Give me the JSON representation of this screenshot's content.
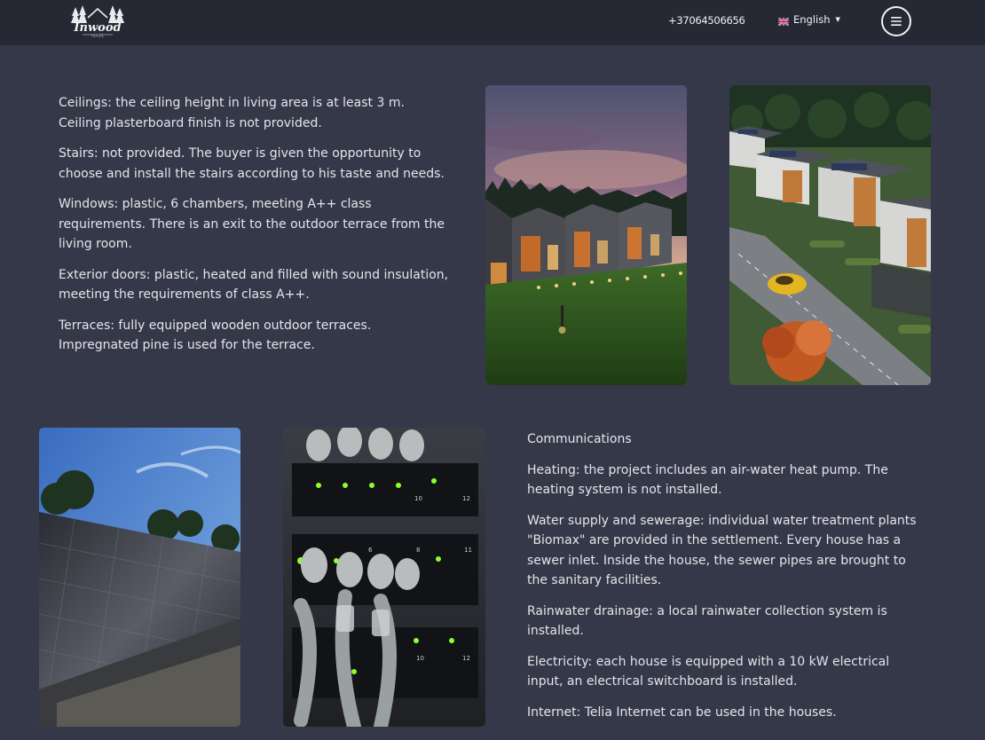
{
  "header": {
    "logo_alt": "Inwood House",
    "phone": "+37064506656",
    "language": "English",
    "menu_icon": "hamburger-icon"
  },
  "section1": {
    "paragraphs": [
      "Ceilings: the ceiling height in living area is at least 3 m. Ceiling plasterboard finish is not provided.",
      "Stairs: not provided. The buyer is given the opportunity to choose and install the stairs according to his taste and needs.",
      "Windows: plastic, 6 chambers, meeting A++ class requirements. There is an exit to the outdoor terrace from the living room.",
      "Exterior doors: plastic, heated and filled with sound insulation, meeting the requirements of class A++.",
      "Terraces: fully equipped wooden outdoor terraces. Impregnated pine is used for the terrace."
    ]
  },
  "section2": {
    "heading": "Communications",
    "paragraphs": [
      "Heating: the project includes an air-water heat pump. The heating system is not installed.",
      "Water supply and sewerage: individual water treatment plants \"Biomax\" are provided in the settlement. Every house has a sewer inlet. Inside the house, the sewer pipes are brought to the sanitary facilities.",
      "Rainwater drainage: a local rainwater collection system is installed.",
      "Electricity: each house is equipped with a 10 kW electrical input, an electrical switchboard is installed.",
      "Internet: Telia Internet can be used in the houses."
    ]
  },
  "colors": {
    "page_bg": "#353848",
    "header_bg": "#262934",
    "text": "#e4e5ea"
  }
}
